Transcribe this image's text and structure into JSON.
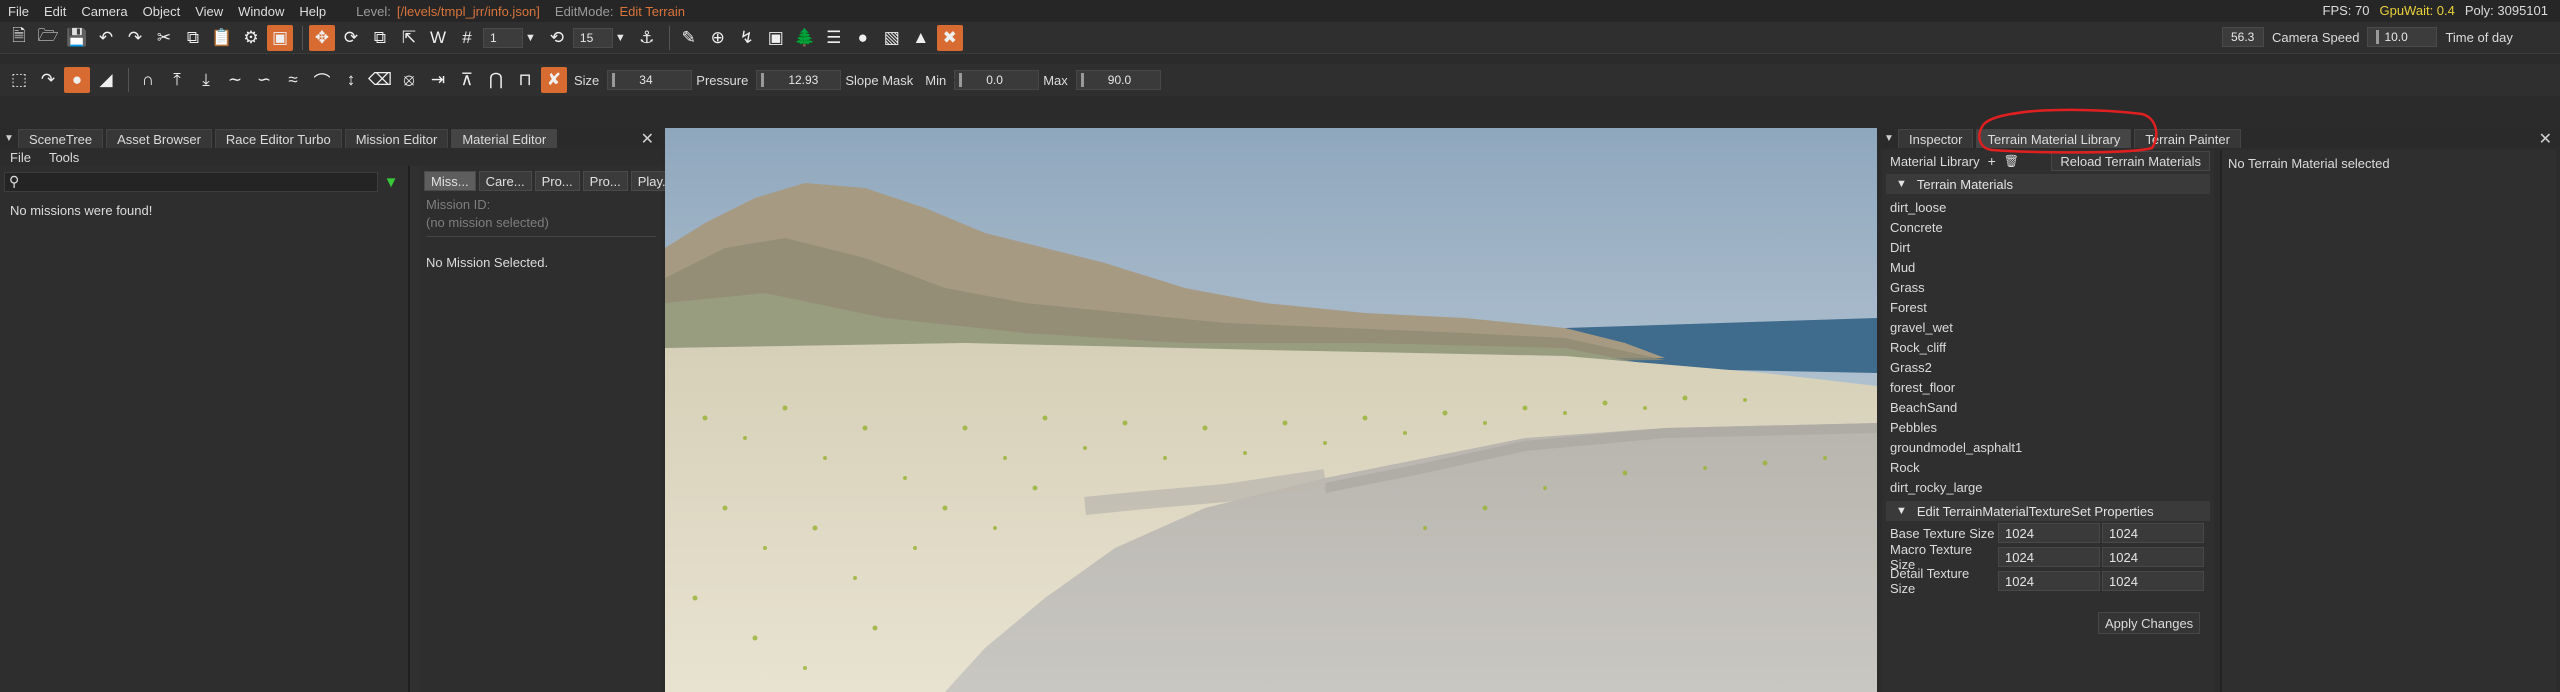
{
  "menubar": {
    "items": [
      "File",
      "Edit",
      "Camera",
      "Object",
      "View",
      "Window",
      "Help"
    ],
    "level_label": "Level:",
    "level_value": "[/levels/tmpl_jrr/info.json]",
    "editmode_label": "EditMode:",
    "editmode_value": "Edit Terrain",
    "fps": "FPS: 70",
    "gpuwait": "GpuWait: 0.4",
    "poly": "Poly: 3095101"
  },
  "toolbar1": {
    "snap_value": "1",
    "rotate_value": "15",
    "fov_value": "56.3",
    "camera_speed_label": "Camera Speed",
    "camera_speed_value": "10.0",
    "time_of_day_label": "Time of day"
  },
  "toolbar2": {
    "size_label": "Size",
    "size_value": "34",
    "pressure_label": "Pressure",
    "pressure_value": "12.93",
    "slope_label": "Slope Mask",
    "min_label": "Min",
    "min_value": "0.0",
    "max_label": "Max",
    "max_value": "90.0"
  },
  "left_panel": {
    "tabs": [
      "SceneTree",
      "Asset Browser",
      "Race Editor Turbo",
      "Mission Editor",
      "Material Editor"
    ],
    "active_tab": "Material Editor",
    "menu": [
      "File",
      "Tools"
    ],
    "search_placeholder": "",
    "no_missions": "No missions were found!",
    "detail_tabs": [
      "Miss...",
      "Care...",
      "Pro...",
      "Pro...",
      "Play..."
    ],
    "mission_id_label": "Mission ID:",
    "mission_id_value": "(no mission selected)",
    "no_mission_selected": "No Mission Selected."
  },
  "right_panel": {
    "tabs": [
      "Inspector",
      "Terrain Material Library",
      "Terrain Painter"
    ],
    "active_tab": "Terrain Material Library",
    "material_library_label": "Material Library",
    "reload_button": "Reload Terrain Materials",
    "terrain_materials_header": "Terrain Materials",
    "materials": [
      "dirt_loose",
      "Concrete",
      "Dirt",
      "Mud",
      "Grass",
      "Forest",
      "gravel_wet",
      "Rock_cliff",
      "Grass2",
      "forest_floor",
      "BeachSand",
      "Pebbles",
      "groundmodel_asphalt1",
      "Rock",
      "dirt_rocky_large"
    ],
    "texture_props_header": "Edit TerrainMaterialTextureSet Properties",
    "base_texture_label": "Base Texture Size",
    "macro_texture_label": "Macro Texture Size",
    "detail_texture_label": "Detail Texture Size",
    "base_values": [
      "1024",
      "1024"
    ],
    "macro_values": [
      "1024",
      "1024"
    ],
    "detail_values": [
      "1024",
      "1024"
    ],
    "apply_button": "Apply Changes",
    "no_material_selected": "No Terrain Material selected"
  },
  "colors": {
    "accent_orange": "#d86b32",
    "annotation_red": "#e02020",
    "filter_green": "#39c839"
  }
}
